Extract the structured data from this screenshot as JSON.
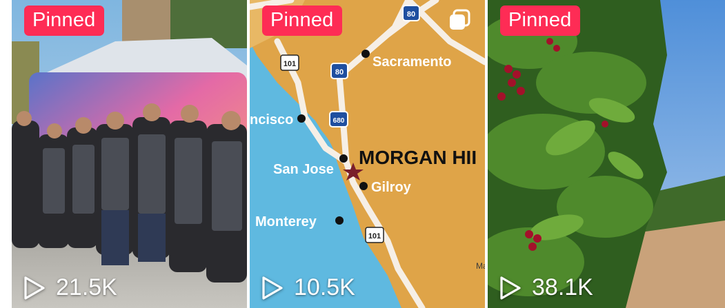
{
  "videos": [
    {
      "pinned_label": "Pinned",
      "views": "21.5K",
      "icon": "play-icon"
    },
    {
      "pinned_label": "Pinned",
      "views": "10.5K",
      "icon": "play-icon",
      "map": {
        "cities": [
          "Sacramento",
          "ncisco",
          "San Jose",
          "Gilroy",
          "Monterey"
        ],
        "highlight": "MORGAN HII",
        "shields": [
          "80",
          "101",
          "80",
          "680",
          "101"
        ],
        "corner_text": "Ma"
      }
    },
    {
      "pinned_label": "Pinned",
      "views": "38.1K",
      "icon": "play-icon"
    }
  ],
  "colors": {
    "badge": "#fe2c55",
    "map_land": "#dfa448",
    "map_water": "#5fb9e0"
  }
}
